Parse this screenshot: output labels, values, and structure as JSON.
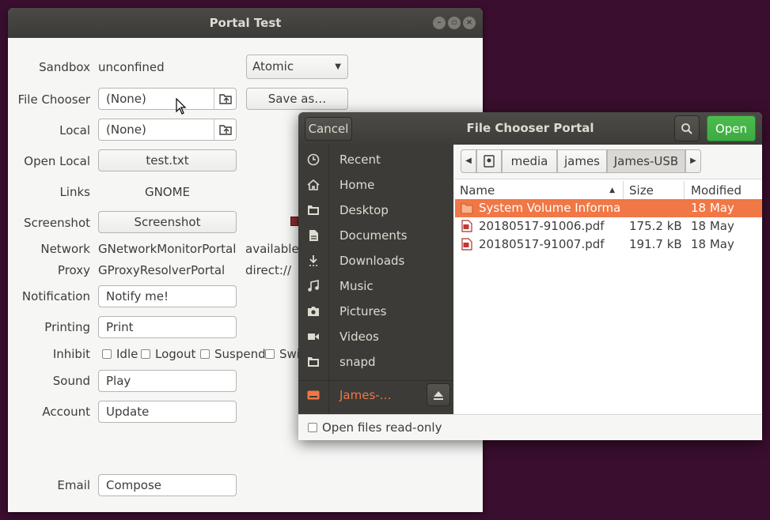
{
  "portal": {
    "title": "Portal Test",
    "sandbox": {
      "label": "Sandbox",
      "value": "unconfined",
      "combo": "Atomic"
    },
    "file_chooser": {
      "label": "File Chooser",
      "value": "(None)",
      "save_as": "Save as…"
    },
    "local": {
      "label": "Local",
      "value": "(None)"
    },
    "open_local": {
      "label": "Open Local",
      "button": "test.txt"
    },
    "links": {
      "label": "Links",
      "value": "GNOME"
    },
    "screenshot": {
      "label": "Screenshot",
      "button": "Screenshot"
    },
    "network": {
      "label": "Network",
      "value": "GNetworkMonitorPortal",
      "status": "available,"
    },
    "proxy": {
      "label": "Proxy",
      "value": "GProxyResolverPortal",
      "status": "direct://"
    },
    "notification": {
      "label": "Notification",
      "value": "Notify me!"
    },
    "printing": {
      "label": "Printing",
      "value": "Print"
    },
    "inhibit": {
      "label": "Inhibit",
      "options": [
        "Idle",
        "Logout",
        "Suspend",
        "Swi"
      ]
    },
    "sound": {
      "label": "Sound",
      "value": "Play"
    },
    "account": {
      "label": "Account",
      "value": "Update"
    },
    "email": {
      "label": "Email",
      "value": "Compose"
    }
  },
  "chooser": {
    "title": "File Chooser Portal",
    "cancel": "Cancel",
    "open": "Open",
    "sidebar": [
      {
        "label": "Recent",
        "icon": "clock-icon"
      },
      {
        "label": "Home",
        "icon": "home-icon"
      },
      {
        "label": "Desktop",
        "icon": "folder-icon"
      },
      {
        "label": "Documents",
        "icon": "document-icon"
      },
      {
        "label": "Downloads",
        "icon": "download-icon"
      },
      {
        "label": "Music",
        "icon": "music-icon"
      },
      {
        "label": "Pictures",
        "icon": "camera-icon"
      },
      {
        "label": "Videos",
        "icon": "video-icon"
      },
      {
        "label": "snapd",
        "icon": "folder-icon"
      }
    ],
    "device": {
      "label": "James-…",
      "icon": "usb-drive-icon"
    },
    "breadcrumbs": [
      "media",
      "james",
      "James-USB"
    ],
    "columns": {
      "name": "Name",
      "size": "Size",
      "modified": "Modified"
    },
    "files": [
      {
        "name": "System Volume Informa…",
        "size": "",
        "modified": "18 May",
        "icon": "folder-icon"
      },
      {
        "name": "20180517-91006.pdf",
        "size": "175.2 kB",
        "modified": "18 May",
        "icon": "pdf-icon"
      },
      {
        "name": "20180517-91007.pdf",
        "size": "191.7 kB",
        "modified": "18 May",
        "icon": "pdf-icon"
      }
    ],
    "read_only": "Open files read-only",
    "accent": "#f07746",
    "open_color": "#3eaa41"
  }
}
